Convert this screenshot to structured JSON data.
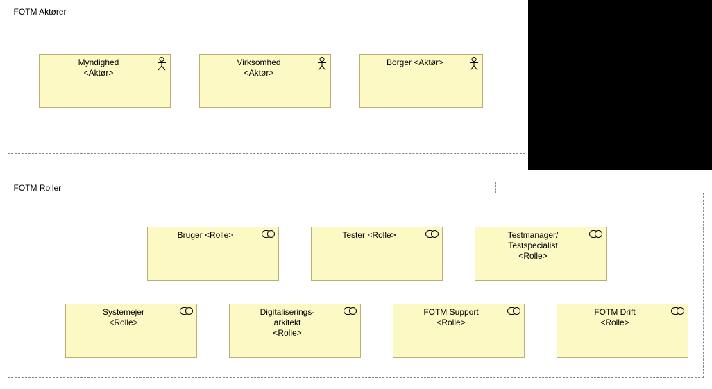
{
  "groups": {
    "aktorer": {
      "title": "FOTM Aktører"
    },
    "roller": {
      "title": "FOTM Roller"
    }
  },
  "actors": {
    "myndighed": {
      "name": "Myndighed",
      "stereotype": "<Aktør>"
    },
    "virksomhed": {
      "name": "Virksomhed",
      "stereotype": "<Aktør>"
    },
    "borger": {
      "label": "Borger <Aktør>"
    }
  },
  "roles": {
    "bruger": {
      "label": "Bruger <Rolle>"
    },
    "tester": {
      "label": "Tester <Rolle>"
    },
    "testmanager": {
      "line1": "Testmanager/",
      "line2": "Testspecialist",
      "stereotype": "<Rolle>"
    },
    "systemejer": {
      "name": "Systemejer",
      "stereotype": "<Rolle>"
    },
    "digitaliseringsarkitekt": {
      "line1": "Digitaliserings-",
      "line2": "arkitekt",
      "stereotype": "<Rolle>"
    },
    "fotm_support": {
      "name": "FOTM Support",
      "stereotype": "<Rolle>"
    },
    "fotm_drift": {
      "name": "FOTM Drift",
      "stereotype": "<Rolle>"
    }
  }
}
